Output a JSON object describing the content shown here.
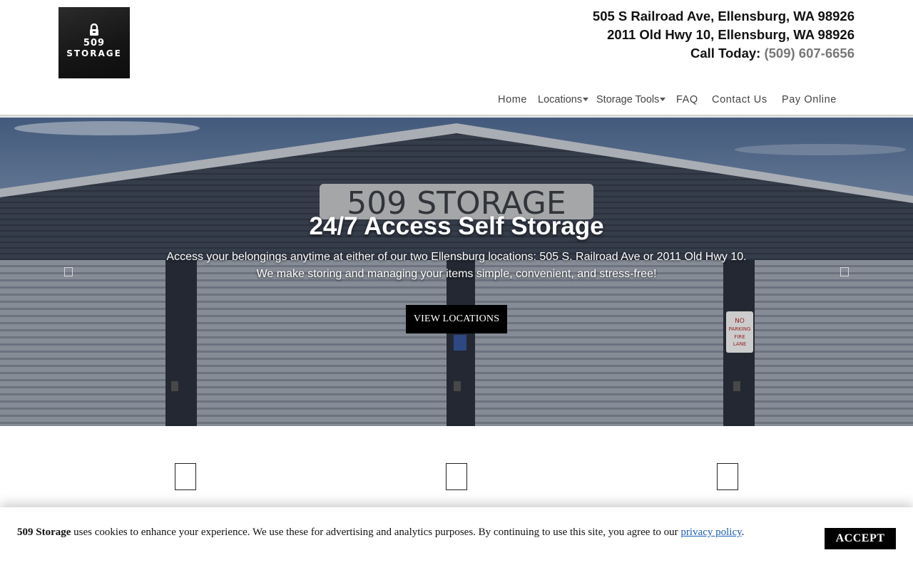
{
  "brand": {
    "logo_line1": "509",
    "logo_line2": "STORAGE"
  },
  "contact": {
    "address1": "505 S Railroad Ave, Ellensburg, WA 98926",
    "address2": "2011 Old Hwy 10, Ellensburg, WA 98926",
    "call_label": "Call Today: ",
    "phone": "(509) 607-6656"
  },
  "nav": {
    "items": [
      {
        "label": "Home"
      },
      {
        "label": "Locations",
        "dropdown": true
      },
      {
        "label": "Storage Tools",
        "dropdown": true
      },
      {
        "label": "FAQ"
      },
      {
        "label": "Contact Us"
      },
      {
        "label": "Pay Online"
      }
    ]
  },
  "hero": {
    "sign_text": "509 STORAGE",
    "title": "24/7 Access Self Storage",
    "text_line1": "Access your belongings anytime at either of our two Ellensburg locations: 505 S. Railroad Ave or 2011 Old Hwy 10.",
    "text_line2": "We make storing and managing your items simple, convenient, and stress-free!",
    "button_label": "VIEW LOCATIONS",
    "no_parking_sign": [
      "NO",
      "PARKING",
      "FIRE",
      "LANE"
    ]
  },
  "cookie_banner": {
    "brand": "509 Storage",
    "text": " uses cookies to enhance your experience. We use these for advertising and analytics purposes. By continuing to use this site, you agree to our ",
    "link_text": "privacy policy",
    "end": ".",
    "accept_label": "ACCEPT"
  },
  "colors": {
    "phone": "#777777",
    "button_bg": "#000000",
    "link": "#1a5fb4"
  },
  "icons": [
    "lock-icon",
    "caret-down-icon",
    "carousel-prev-icon",
    "carousel-next-icon",
    "feature-icon"
  ]
}
